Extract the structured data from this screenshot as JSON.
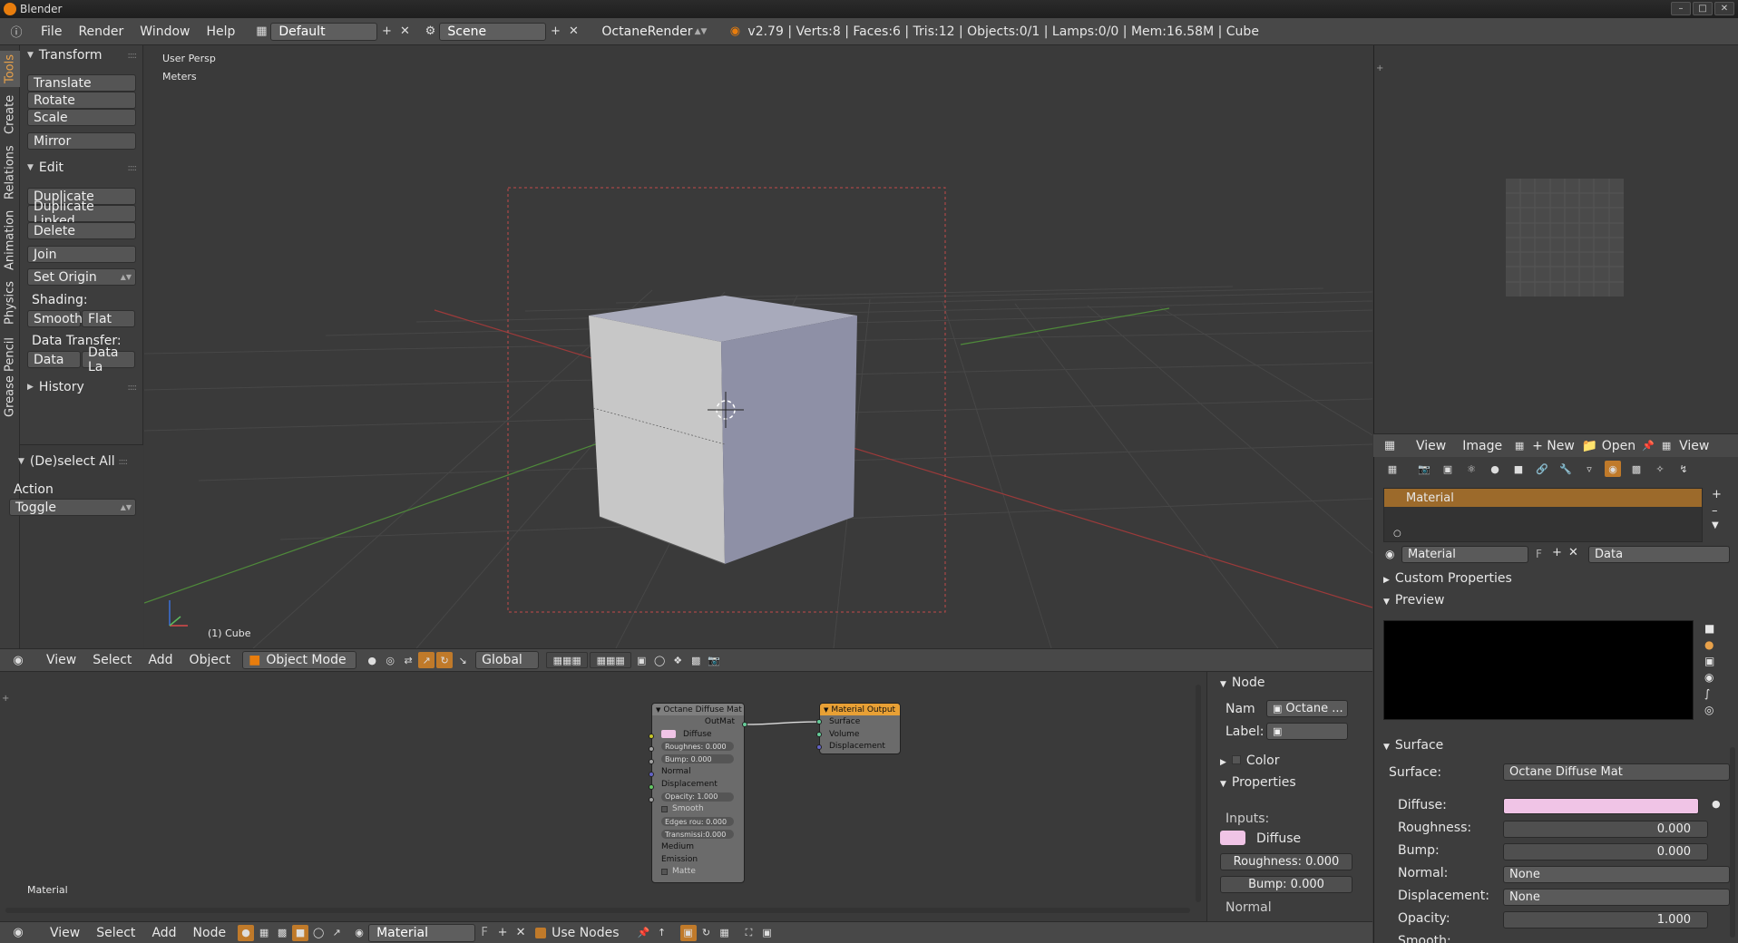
{
  "window": {
    "title": "Blender"
  },
  "info_header": {
    "menus": [
      "File",
      "Render",
      "Window",
      "Help"
    ],
    "layout": "Default",
    "scene": "Scene",
    "render_engine": "OctaneRender",
    "stats": "v2.79 | Verts:8 | Faces:6 | Tris:12 | Objects:0/1 | Lamps:0/0 | Mem:16.58M | Cube"
  },
  "tool_tabs": [
    "Tools",
    "Create",
    "Relations",
    "Animation",
    "Physics",
    "Grease Pencil"
  ],
  "toolshelf": {
    "transform": {
      "title": "Transform",
      "buttons": [
        "Translate",
        "Rotate",
        "Scale",
        "Mirror"
      ]
    },
    "edit": {
      "title": "Edit",
      "buttons": [
        "Duplicate",
        "Duplicate Linked",
        "Delete",
        "Join",
        "Set Origin"
      ],
      "shading_label": "Shading:",
      "smooth": "Smooth",
      "flat": "Flat",
      "data_transfer_label": "Data Transfer:",
      "data": "Data",
      "data_la": "Data La"
    },
    "history": {
      "title": "History"
    },
    "operator": {
      "title": "(De)select All",
      "action_label": "Action",
      "action_value": "Toggle"
    }
  },
  "viewport": {
    "view_name": "User Persp",
    "units": "Meters",
    "object_label": "(1) Cube"
  },
  "viewport_header": {
    "menus": [
      "View",
      "Select",
      "Add",
      "Object"
    ],
    "mode": "Object Mode",
    "orientation": "Global"
  },
  "node_editor": {
    "material_label": "Material",
    "diffuse_node": {
      "title": "Octane Diffuse Mat",
      "output": "OutMat",
      "rows": [
        "Diffuse",
        "Roughnes: 0.000",
        "Bump: 0.000",
        "Normal",
        "Displacement",
        "Opacity: 1.000",
        "Smooth",
        "Edges rou: 0.000",
        "Transmissi:0.000",
        "Medium",
        "Emission",
        "Matte"
      ]
    },
    "output_node": {
      "title": "Material Output",
      "rows": [
        "Surface",
        "Volume",
        "Displacement"
      ]
    },
    "sidebar": {
      "node_title": "Node",
      "name_label": "Nam",
      "name_value": "Octane ...",
      "label_label": "Label:",
      "color_title": "Color",
      "properties_title": "Properties",
      "inputs_label": "Inputs:",
      "diffuse_label": "Diffuse",
      "roughness": "Roughness: 0.000",
      "bump": "Bump: 0.000",
      "normal": "Normal"
    }
  },
  "node_header": {
    "menus": [
      "View",
      "Select",
      "Add",
      "Node"
    ],
    "material": "Material",
    "fake_user": "F",
    "use_nodes": "Use Nodes"
  },
  "uv_header": {
    "menus": [
      "View",
      "Image"
    ],
    "new": "New",
    "open": "Open",
    "view": "View"
  },
  "properties": {
    "slot_name": "Material",
    "material_field": "Material",
    "fake_user": "F",
    "link": "Data",
    "custom_properties": "Custom Properties",
    "preview": "Preview",
    "surface_panel": "Surface",
    "surface_label": "Surface:",
    "surface_value": "Octane Diffuse Mat",
    "diffuse_label": "Diffuse:",
    "diffuse_color": "#f0c4e6",
    "roughness_label": "Roughness:",
    "roughness_value": "0.000",
    "bump_label": "Bump:",
    "bump_value": "0.000",
    "normal_label": "Normal:",
    "normal_value": "None",
    "displacement_label": "Displacement:",
    "displacement_value": "None",
    "opacity_label": "Opacity:",
    "opacity_value": "1.000",
    "smooth_label": "Smooth:"
  },
  "colors": {
    "accent_orange": "#e87d0d",
    "selected_slot": "#9c6a2b",
    "node_output_header": "#e8a035"
  }
}
